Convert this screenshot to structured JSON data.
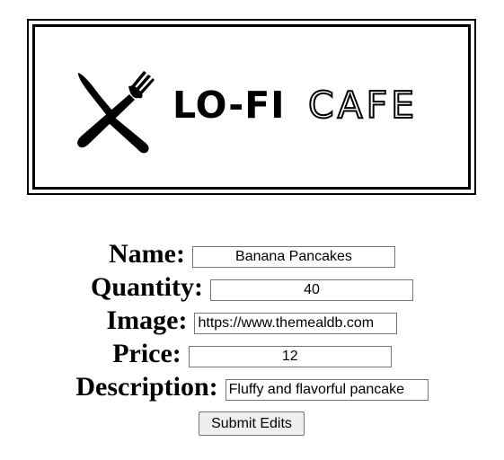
{
  "logo": {
    "text_bold": "LO-FI",
    "text_outline": "CAFE",
    "icon": "knife-fork-icon"
  },
  "form": {
    "name_label": "Name:",
    "name_value": "Banana Pancakes",
    "quantity_label": "Quantity:",
    "quantity_value": "40",
    "image_label": "Image:",
    "image_value": "https://www.themealdb.com",
    "price_label": "Price:",
    "price_value": "12",
    "description_label": "Description:",
    "description_value": "Fluffy and flavorful pancake",
    "submit_label": "Submit Edits"
  }
}
